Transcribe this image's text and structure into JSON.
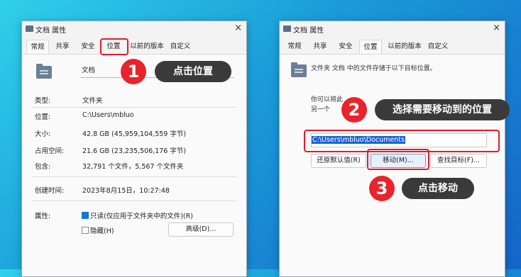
{
  "left_window": {
    "title": "文档 属性",
    "close": "×",
    "tabs": [
      "常规",
      "共享",
      "安全",
      "位置",
      "以前的版本",
      "自定义"
    ],
    "name_value": "文档",
    "props": [
      {
        "label": "类型:",
        "value": "文件夹"
      },
      {
        "label": "位置:",
        "value": "C:\\Users\\mbluo"
      },
      {
        "label": "大小:",
        "value": "42.8 GB (45,959,104,559 字节)"
      },
      {
        "label": "占用空间:",
        "value": "21.6 GB (23,235,506,176 字节)"
      },
      {
        "label": "包含:",
        "value": "32,791 个文件，5,567 个文件夹"
      }
    ],
    "created_label": "创建时间:",
    "created_value": "2023年8月15日，10:27:48",
    "attr_label": "属性:",
    "readonly_label": "只读(仅应用于文件夹中的文件)(R)",
    "hidden_label": "隐藏(H)",
    "advanced_button": "高级(D)..."
  },
  "right_window": {
    "title": "文档 属性",
    "close": "×",
    "tabs": [
      "常规",
      "共享",
      "安全",
      "位置",
      "以前的版本",
      "自定义"
    ],
    "info_text": "文件夹 文档 中的文件存储于以下目标位置。",
    "desc_line1": "你可以将此",
    "desc_line2": "另一个",
    "path_value": "C:\\Users\\mbluo\\Documents",
    "restore_button": "还原默认值(R)",
    "move_button": "移动(M)...",
    "find_button": "查找目标(F)..."
  },
  "callouts": [
    {
      "number": "1",
      "text": "点击位置"
    },
    {
      "number": "2",
      "text": "选择需要移动到的位置"
    },
    {
      "number": "3",
      "text": "点击移动"
    }
  ],
  "colors": {
    "accent_red": "#e31b2b",
    "selection_blue": "#1a64d2",
    "label_bg": "#3a3a3a"
  }
}
